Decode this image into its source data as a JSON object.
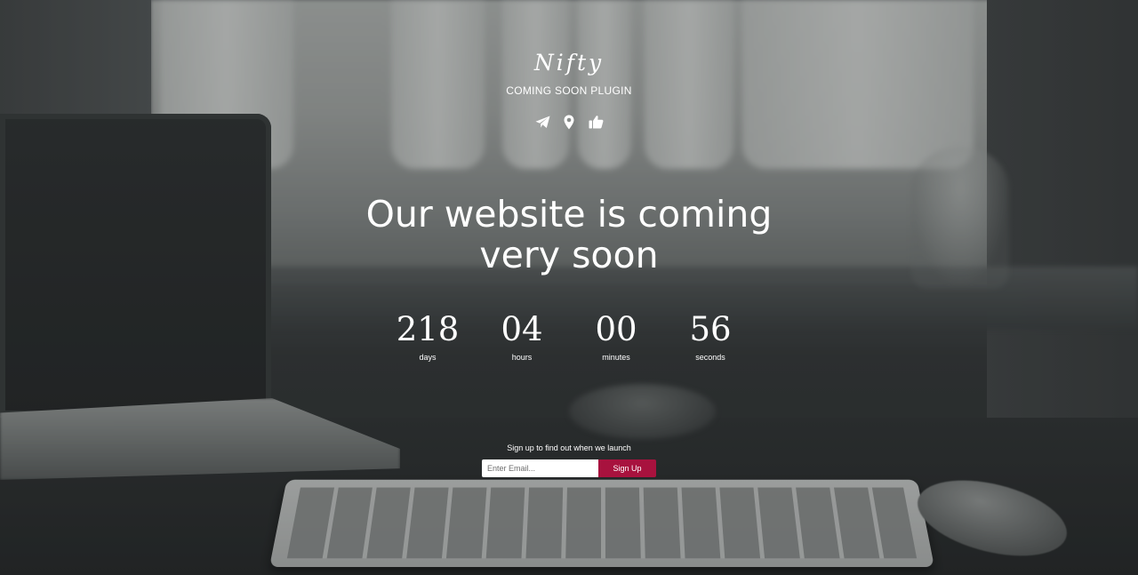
{
  "brand": {
    "logo": "Nifty",
    "tagline": "COMING SOON PLUGIN"
  },
  "social": [
    {
      "icon": "paper-plane-icon",
      "color": "#ffffff"
    },
    {
      "icon": "map-marker-icon",
      "color": "#ffffff"
    },
    {
      "icon": "thumbs-up-icon",
      "color": "#ffffff"
    }
  ],
  "headline": {
    "line1": "Our website is coming",
    "line2": "very soon"
  },
  "countdown": {
    "days": {
      "value": "218",
      "label": "days"
    },
    "hours": {
      "value": "04",
      "label": "hours"
    },
    "minutes": {
      "value": "00",
      "label": "minutes"
    },
    "seconds": {
      "value": "56",
      "label": "seconds"
    }
  },
  "signup": {
    "prompt": "Sign up to find out when we launch",
    "email_placeholder": "Enter Email...",
    "button_label": "Sign Up",
    "button_color": "#a8123e"
  }
}
